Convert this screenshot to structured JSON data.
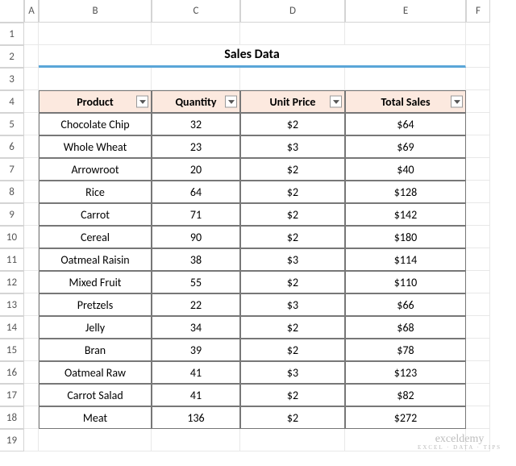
{
  "columns": [
    "A",
    "B",
    "C",
    "D",
    "E",
    "F"
  ],
  "row_count": 19,
  "title": "Sales Data",
  "headers": {
    "product": "Product",
    "quantity": "Quantity",
    "unit_price": "Unit Price",
    "total_sales": "Total Sales"
  },
  "rows": [
    {
      "product": "Chocolate Chip",
      "quantity": "32",
      "unit_price": "$2",
      "total_sales": "$64"
    },
    {
      "product": "Whole Wheat",
      "quantity": "23",
      "unit_price": "$3",
      "total_sales": "$69"
    },
    {
      "product": "Arrowroot",
      "quantity": "20",
      "unit_price": "$2",
      "total_sales": "$40"
    },
    {
      "product": "Rice",
      "quantity": "64",
      "unit_price": "$2",
      "total_sales": "$128"
    },
    {
      "product": "Carrot",
      "quantity": "71",
      "unit_price": "$2",
      "total_sales": "$142"
    },
    {
      "product": "Cereal",
      "quantity": "90",
      "unit_price": "$2",
      "total_sales": "$180"
    },
    {
      "product": "Oatmeal Raisin",
      "quantity": "38",
      "unit_price": "$3",
      "total_sales": "$114"
    },
    {
      "product": "Mixed Fruit",
      "quantity": "55",
      "unit_price": "$2",
      "total_sales": "$110"
    },
    {
      "product": "Pretzels",
      "quantity": "22",
      "unit_price": "$3",
      "total_sales": "$66"
    },
    {
      "product": "Jelly",
      "quantity": "34",
      "unit_price": "$2",
      "total_sales": "$68"
    },
    {
      "product": "Bran",
      "quantity": "39",
      "unit_price": "$2",
      "total_sales": "$78"
    },
    {
      "product": "Oatmeal Raw",
      "quantity": "41",
      "unit_price": "$3",
      "total_sales": "$123"
    },
    {
      "product": "Carrot Salad",
      "quantity": "41",
      "unit_price": "$2",
      "total_sales": "$82"
    },
    {
      "product": "Meat",
      "quantity": "136",
      "unit_price": "$2",
      "total_sales": "$272"
    }
  ],
  "watermark": {
    "main": "exceldemy",
    "sub": "EXCEL · DATA · TIPS"
  }
}
